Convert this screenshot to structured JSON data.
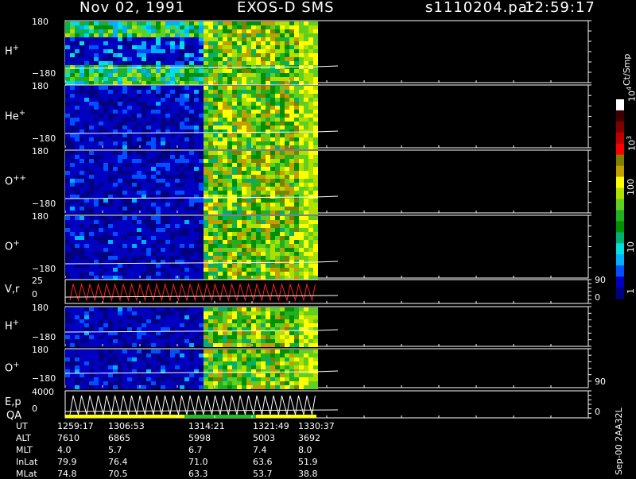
{
  "header": {
    "date": "Nov 02, 1991",
    "mission": "EXOS-D SMS",
    "file": "s1110204.par",
    "time": "12:59:17"
  },
  "colorbar": {
    "unit": "Ct/Smp",
    "labels": [
      "1",
      "10",
      "100",
      "10",
      "10"
    ],
    "exponents": [
      "",
      "",
      "",
      "3",
      "4"
    ],
    "colors": [
      "#000080",
      "#0000c0",
      "#0050ff",
      "#00b0ff",
      "#00e0e0",
      "#00b070",
      "#009000",
      "#20b020",
      "#60d020",
      "#b0e000",
      "#ffff00",
      "#c0a000",
      "#808000",
      "#ff0000",
      "#c00000",
      "#800000",
      "#400000",
      "#ffffff"
    ]
  },
  "panels": [
    {
      "id": "h-plus",
      "label": "H",
      "sup": "+",
      "top": "180",
      "bottom": "−180"
    },
    {
      "id": "he-plus",
      "label": "He",
      "sup": "+",
      "top": "180",
      "bottom": "−180"
    },
    {
      "id": "o-plusplus",
      "label": "O",
      "sup": "++",
      "top": "180",
      "bottom": "−180"
    },
    {
      "id": "o-plus",
      "label": "O",
      "sup": "+",
      "top": "180",
      "bottom": "−180"
    },
    {
      "id": "vr",
      "label": "V,r",
      "sup": "",
      "top": "25",
      "bottom": "0",
      "right_top": "90",
      "right_bottom": "0"
    },
    {
      "id": "h-plus-2",
      "label": "H",
      "sup": "+",
      "top": "180",
      "bottom": "−180"
    },
    {
      "id": "o-plus-2",
      "label": "O",
      "sup": "+",
      "top": "180",
      "bottom": "−180",
      "right_bottom": "90"
    },
    {
      "id": "ep-qa",
      "label": "E,p",
      "label2": "QA",
      "sup": "",
      "top": "4000",
      "bottom": "0",
      "right_bottom": "0"
    }
  ],
  "footer": {
    "rows": [
      {
        "name": "UT",
        "values": [
          "1259:17",
          "1306:53",
          "1314:21",
          "1321:49",
          "1330:37"
        ]
      },
      {
        "name": "ALT",
        "values": [
          "7610",
          "6865",
          "5998",
          "5003",
          "3692"
        ]
      },
      {
        "name": "MLT",
        "values": [
          "4.0",
          "5.7",
          "6.7",
          "7.4",
          "8.0"
        ]
      },
      {
        "name": "InLat",
        "values": [
          "79.9",
          "76.4",
          "71.0",
          "63.6",
          "51.9"
        ]
      },
      {
        "name": "MLat",
        "values": [
          "74.8",
          "70.5",
          "63.3",
          "53.7",
          "38.8"
        ]
      }
    ],
    "side_note": "Sep-00 2AA32L"
  },
  "chart_data": {
    "type": "heatmap",
    "title": "Nov 02, 1991 EXOS-D SMS",
    "x": [
      "1259:17",
      "1306:53",
      "1314:21",
      "1321:49",
      "1330:37"
    ],
    "series": [
      {
        "name": "H+",
        "ylim": [
          -180,
          180
        ]
      },
      {
        "name": "He+",
        "ylim": [
          -180,
          180
        ]
      },
      {
        "name": "O++",
        "ylim": [
          -180,
          180
        ]
      },
      {
        "name": "O+",
        "ylim": [
          -180,
          180
        ]
      },
      {
        "name": "V,r",
        "ylim": [
          0,
          25
        ]
      },
      {
        "name": "H+",
        "ylim": [
          -180,
          180
        ]
      },
      {
        "name": "O+",
        "ylim": [
          -180,
          180
        ]
      },
      {
        "name": "E,p",
        "ylim": [
          0,
          4000
        ]
      }
    ],
    "colorbar_range": [
      1,
      10000
    ],
    "colorbar_scale": "log"
  }
}
